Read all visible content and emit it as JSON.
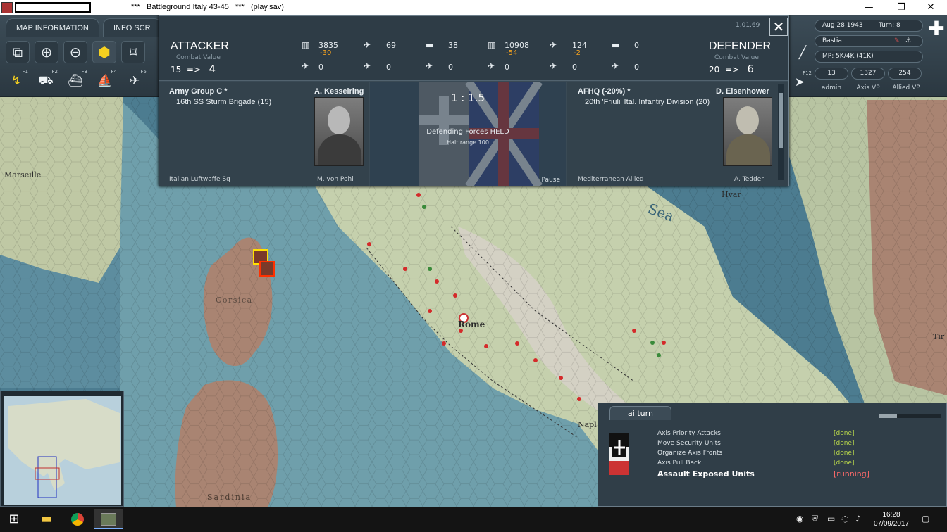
{
  "window": {
    "title": "***   Battleground Italy 43-45   ***   (play.sav)",
    "min": "—",
    "max": "❐",
    "close": "✕"
  },
  "tabs": {
    "map_info": "MAP INFORMATION",
    "info_screen": "INFO SCR"
  },
  "toolbar": {
    "row1": [
      "window-icon",
      "zoom-in-icon",
      "zoom-out-icon",
      "hex-grid-icon",
      "frame-icon"
    ],
    "row2_keys": [
      "F1",
      "F2",
      "F3",
      "F4",
      "F5"
    ]
  },
  "status_panel": {
    "date": "Aug 28 1943",
    "turn": "Turn: 8",
    "location": "Bastia",
    "mp": "MP: 5K/4K (41K)",
    "admin_value": "13",
    "admin_label": "admin",
    "axis_vp": "1327",
    "axis_vp_label": "Axis VP",
    "allied_vp": "254",
    "allied_vp_label": "Allied VP",
    "side_key": "F12"
  },
  "combat": {
    "version": "1.01.69",
    "attacker": {
      "title": "ATTACKER",
      "cv_label": "Combat Value",
      "cv_from": "15",
      "cv_arrow": "=>",
      "cv_to": "4",
      "men": "3835",
      "men_loss": "-30",
      "air": "69",
      "tanks": "38",
      "r2a": "0",
      "r2b": "0",
      "r2c": "0",
      "hq": "Army Group C  *",
      "commander": "A. Kesselring",
      "unit": "16th SS Sturm Brigade (15)",
      "cut_left": "Italian Luftwaffe Sq",
      "cut_right": "M. von Pohl"
    },
    "defender": {
      "title": "DEFENDER",
      "cv_label": "Combat Value",
      "cv_from": "20",
      "cv_arrow": "=>",
      "cv_to": "6",
      "men": "10908",
      "men_loss": "-54",
      "air": "124",
      "air_loss": "-2",
      "tanks": "0",
      "r2a": "0",
      "r2b": "0",
      "r2c": "0",
      "hq": "AFHQ  (-20%)  *",
      "commander": "D. Eisenhower",
      "unit": "20th 'Friuli' Ital. Infantry Division (20)",
      "cut_left": "Mediterranean Allied",
      "cut_right": "A. Tedder"
    },
    "ratio": "1 : 1.5",
    "result": "Defending Forces HELD",
    "halt": "Halt range 100",
    "pause": "Pause"
  },
  "ai_panel": {
    "tab": "ai turn",
    "progress": 0.3,
    "tasks": [
      {
        "name": "Axis Priority Attacks",
        "status": "[done]"
      },
      {
        "name": "Move Security Units",
        "status": "[done]"
      },
      {
        "name": "Organize Axis Fronts",
        "status": "[done]"
      },
      {
        "name": "Axis Pull Back",
        "status": "[done]"
      },
      {
        "name": "Assault Exposed Units",
        "status": "[running]"
      }
    ]
  },
  "map_labels": {
    "marseille": "Marseille",
    "corsica": "Corsica",
    "rome": "Rome",
    "sardinia": "Sardinia",
    "hvar": "Hvar",
    "sea": "Sea",
    "napl": "Napl",
    "tir": "Tir"
  },
  "taskbar": {
    "time": "16:28",
    "date": "07/09/2017"
  },
  "colors": {
    "sea": "#4f7f93",
    "shallow": "#76a6b0",
    "land": "#c8d3b0",
    "mountain": "#a88370",
    "panel": "#2e3c46",
    "loss": "#f0a020",
    "done": "#b6d44a",
    "running": "#ff6a6a"
  }
}
